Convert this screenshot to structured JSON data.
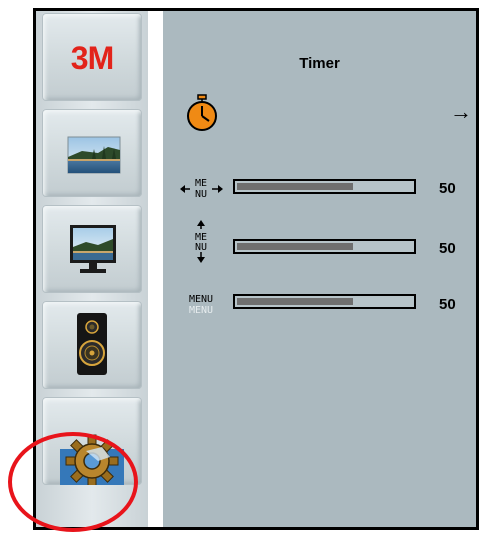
{
  "colors": {
    "highlight_ring": "#e8141b",
    "brand_red": "#e2231a",
    "bar_fill": "#6f6f6f",
    "panel_bg": "#abb9bf"
  },
  "sidebar": {
    "logo_text": "3M",
    "items": [
      {
        "name": "picture",
        "icon": "landscape-photo-icon"
      },
      {
        "name": "display",
        "icon": "monitor-icon"
      },
      {
        "name": "audio",
        "icon": "speaker-icon"
      },
      {
        "name": "settings",
        "icon": "gear-icon",
        "selected": true
      }
    ]
  },
  "main": {
    "title": "Timer",
    "timer_arrow": "→",
    "rows": [
      {
        "icon": "horizontal-position-icon",
        "value": 50,
        "value_label": "50"
      },
      {
        "icon": "vertical-position-icon",
        "value": 50,
        "value_label": "50"
      },
      {
        "icon": "menu-transparency-icon",
        "value": 50,
        "value_label": "50"
      }
    ],
    "value_max": 100,
    "icon_labels": {
      "menu_split_top": "ME",
      "menu_split_bottom": "NU",
      "menu": "MENU"
    }
  }
}
